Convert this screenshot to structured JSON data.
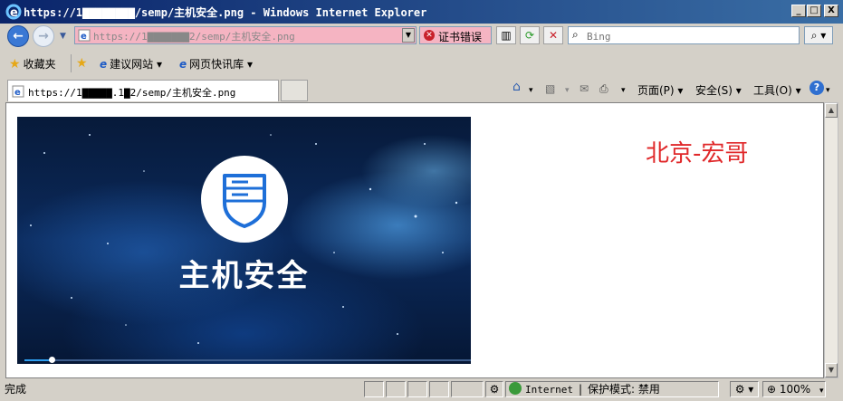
{
  "window": {
    "title": "https://1▇▇▇▇▇▇▇▇/semp/主机安全.png - Windows Internet Explorer",
    "min": "_",
    "max": "□",
    "close": "X"
  },
  "address": {
    "url": "https://1▇▇▇▇▇▇▇2/semp/主机安全.png",
    "cert_error": "证书错误"
  },
  "search": {
    "placeholder": "Bing"
  },
  "favorites": {
    "label": "收藏夹",
    "items": [
      "建议网站 ▾",
      "网页快讯库 ▾"
    ]
  },
  "tab": {
    "label": "https://1▇▇▇▇▇.1▇2/semp/主机安全.png"
  },
  "commands": {
    "page": "页面(P) ▾",
    "safety": "安全(S) ▾",
    "tools": "工具(O) ▾"
  },
  "content": {
    "image_title": "主机安全",
    "side_text": "北京-宏哥",
    "progress": 0.06
  },
  "status": {
    "text": "完成",
    "zone": "Internet",
    "protected_mode": "保护模式: 禁用",
    "zoom": "100%"
  },
  "colors": {
    "address_error_bg": "#f5b4c2",
    "side_text": "#e0282a",
    "progress": "#2e9ef0"
  }
}
